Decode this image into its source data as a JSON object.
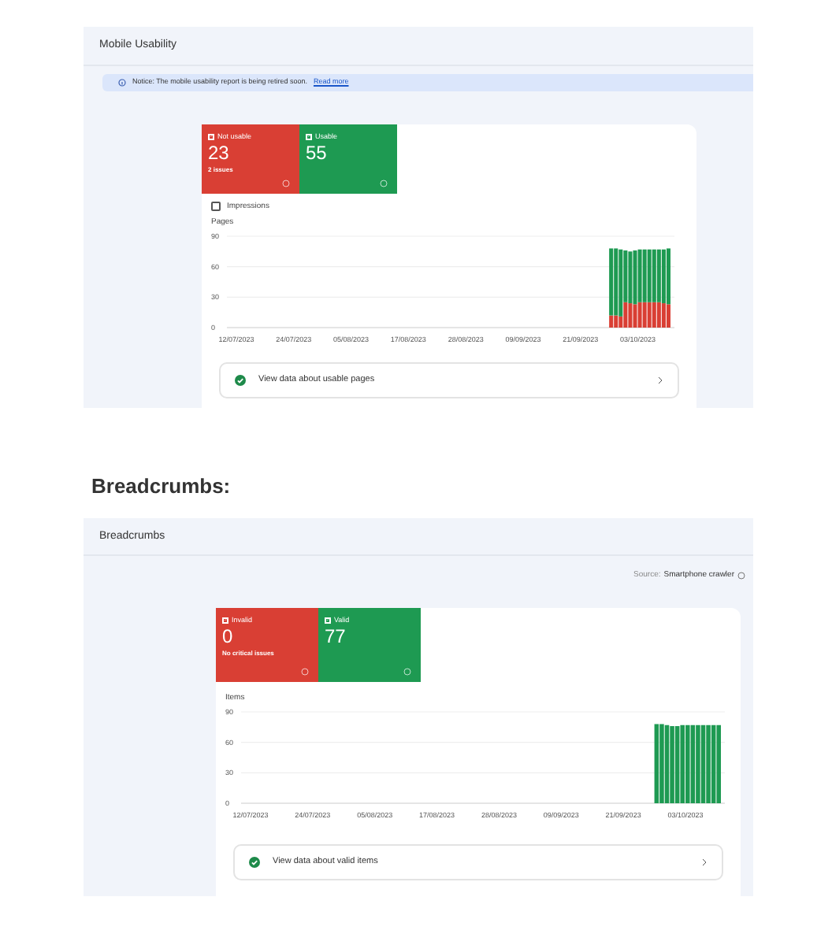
{
  "panels": [
    {
      "title": "Mobile Usability",
      "notice": {
        "text": "Notice: The mobile usability report is being retired soon.",
        "link": "Read more"
      },
      "tiles": [
        {
          "kind": "error",
          "label": "Not usable",
          "checked": true,
          "value": "23",
          "sublabel": "2 issues"
        },
        {
          "kind": "valid",
          "label": "Usable",
          "checked": true,
          "value": "55"
        }
      ],
      "impressions": {
        "label": "Impressions",
        "checked": false
      },
      "chart_data": {
        "type": "bar",
        "stacked": true,
        "ylabel": "Pages",
        "ylim": [
          0,
          90
        ],
        "yticks": [
          0,
          30,
          60,
          90
        ],
        "categories": [
          "12/07/2023",
          null,
          null,
          null,
          null,
          null,
          null,
          null,
          null,
          null,
          null,
          null,
          "24/07/2023",
          null,
          null,
          null,
          null,
          null,
          null,
          null,
          null,
          null,
          null,
          null,
          "05/08/2023",
          null,
          null,
          null,
          null,
          null,
          null,
          null,
          null,
          null,
          null,
          null,
          "17/08/2023",
          null,
          null,
          null,
          null,
          null,
          null,
          null,
          null,
          null,
          null,
          null,
          "28/08/2023",
          null,
          null,
          null,
          null,
          null,
          null,
          null,
          null,
          null,
          null,
          null,
          "09/09/2023",
          null,
          null,
          null,
          null,
          null,
          null,
          null,
          null,
          null,
          null,
          null,
          "21/09/2023",
          null,
          null,
          null,
          null,
          null,
          null,
          null,
          null,
          null,
          null,
          null,
          "03/10/2023",
          null,
          null,
          null,
          null,
          null,
          null
        ],
        "series": [
          {
            "color": "#d93f34",
            "values": [
              null,
              null,
              null,
              null,
              null,
              null,
              null,
              null,
              null,
              null,
              null,
              null,
              null,
              null,
              null,
              null,
              null,
              null,
              null,
              null,
              null,
              null,
              null,
              null,
              null,
              null,
              null,
              null,
              null,
              null,
              null,
              null,
              null,
              null,
              null,
              null,
              null,
              null,
              null,
              null,
              null,
              null,
              null,
              null,
              null,
              null,
              null,
              null,
              null,
              null,
              null,
              null,
              null,
              null,
              null,
              null,
              null,
              null,
              null,
              null,
              null,
              null,
              null,
              null,
              null,
              null,
              null,
              null,
              null,
              null,
              null,
              null,
              null,
              null,
              null,
              null,
              null,
              null,
              12,
              12,
              11,
              25,
              24,
              23,
              25,
              25,
              25,
              25,
              25,
              24,
              23
            ]
          },
          {
            "color": "#1e9a52",
            "values": [
              null,
              null,
              null,
              null,
              null,
              null,
              null,
              null,
              null,
              null,
              null,
              null,
              null,
              null,
              null,
              null,
              null,
              null,
              null,
              null,
              null,
              null,
              null,
              null,
              null,
              null,
              null,
              null,
              null,
              null,
              null,
              null,
              null,
              null,
              null,
              null,
              null,
              null,
              null,
              null,
              null,
              null,
              null,
              null,
              null,
              null,
              null,
              null,
              null,
              null,
              null,
              null,
              null,
              null,
              null,
              null,
              null,
              null,
              null,
              null,
              null,
              null,
              null,
              null,
              null,
              null,
              null,
              null,
              null,
              null,
              null,
              null,
              null,
              null,
              null,
              null,
              null,
              null,
              66,
              66,
              66,
              51,
              51,
              53,
              52,
              52,
              52,
              52,
              52,
              53,
              55
            ]
          }
        ]
      },
      "link_row": "View data about usable pages"
    },
    {
      "heading": "Breadcrumbs:",
      "title": "Breadcrumbs",
      "source": {
        "label": "Source:",
        "value": "Smartphone crawler"
      },
      "tiles": [
        {
          "kind": "error",
          "label": "Invalid",
          "checked": true,
          "value": "0",
          "sublabel": "No critical issues"
        },
        {
          "kind": "valid",
          "label": "Valid",
          "checked": true,
          "value": "77"
        }
      ],
      "chart_data": {
        "type": "bar",
        "stacked": true,
        "ylabel": "Items",
        "ylim": [
          0,
          90
        ],
        "yticks": [
          0,
          30,
          60,
          90
        ],
        "categories": [
          "12/07/2023",
          null,
          null,
          null,
          null,
          null,
          null,
          null,
          null,
          null,
          null,
          null,
          "24/07/2023",
          null,
          null,
          null,
          null,
          null,
          null,
          null,
          null,
          null,
          null,
          null,
          "05/08/2023",
          null,
          null,
          null,
          null,
          null,
          null,
          null,
          null,
          null,
          null,
          null,
          "17/08/2023",
          null,
          null,
          null,
          null,
          null,
          null,
          null,
          null,
          null,
          null,
          null,
          "28/08/2023",
          null,
          null,
          null,
          null,
          null,
          null,
          null,
          null,
          null,
          null,
          null,
          "09/09/2023",
          null,
          null,
          null,
          null,
          null,
          null,
          null,
          null,
          null,
          null,
          null,
          "21/09/2023",
          null,
          null,
          null,
          null,
          null,
          null,
          null,
          null,
          null,
          null,
          null,
          "03/10/2023",
          null,
          null,
          null,
          null,
          null,
          null
        ],
        "series": [
          {
            "color": "#1e9a52",
            "values": [
              null,
              null,
              null,
              null,
              null,
              null,
              null,
              null,
              null,
              null,
              null,
              null,
              null,
              null,
              null,
              null,
              null,
              null,
              null,
              null,
              null,
              null,
              null,
              null,
              null,
              null,
              null,
              null,
              null,
              null,
              null,
              null,
              null,
              null,
              null,
              null,
              null,
              null,
              null,
              null,
              null,
              null,
              null,
              null,
              null,
              null,
              null,
              null,
              null,
              null,
              null,
              null,
              null,
              null,
              null,
              null,
              null,
              null,
              null,
              null,
              null,
              null,
              null,
              null,
              null,
              null,
              null,
              null,
              null,
              null,
              null,
              null,
              null,
              null,
              null,
              null,
              null,
              null,
              78,
              78,
              77,
              76,
              76,
              77,
              77,
              77,
              77,
              77,
              77,
              77,
              77
            ]
          }
        ]
      },
      "link_row": "View data about valid items"
    }
  ]
}
